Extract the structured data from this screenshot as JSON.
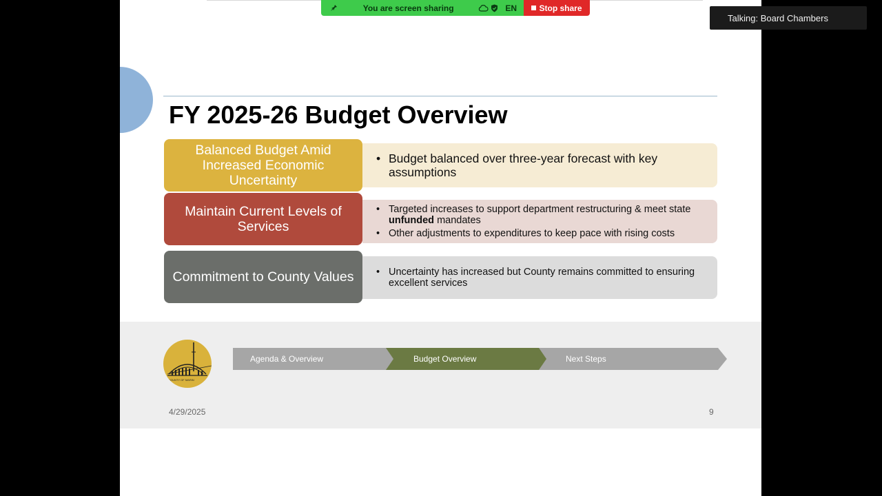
{
  "share_bar": {
    "status": "You are screen sharing",
    "language": "EN",
    "stop_label": "Stop share"
  },
  "talking_indicator": "Talking: Board Chambers",
  "slide": {
    "title": "FY 2025-26 Budget Overview",
    "rows": [
      {
        "label": "Balanced Budget Amid Increased Economic Uncertainty",
        "box_color": "#dcb33f",
        "panel_color": "#f6ecd4",
        "bullets": [
          "Budget balanced over three-year forecast with key assumptions"
        ]
      },
      {
        "label": "Maintain Current Levels of Services",
        "box_color": "#b04a3c",
        "panel_color": "#e9d8d4",
        "bullets": [
          {
            "before": "Targeted increases to support department restructuring & meet state ",
            "bold": "unfunded",
            "after": " mandates"
          },
          "Other adjustments to expenditures to keep pace with rising costs"
        ]
      },
      {
        "label": "Commitment to County Values",
        "box_color": "#6b6e6a",
        "panel_color": "#dcdcdc",
        "bullets": [
          "Uncertainty has increased but County remains committed to ensuring excellent services"
        ]
      }
    ],
    "steps": [
      "Agenda & Overview",
      "Budget Overview",
      "Next Steps"
    ],
    "active_step": "Budget Overview",
    "logo_text": "COUNTY OF MARIN",
    "footer_date": "4/29/2025",
    "page_number": "9"
  }
}
